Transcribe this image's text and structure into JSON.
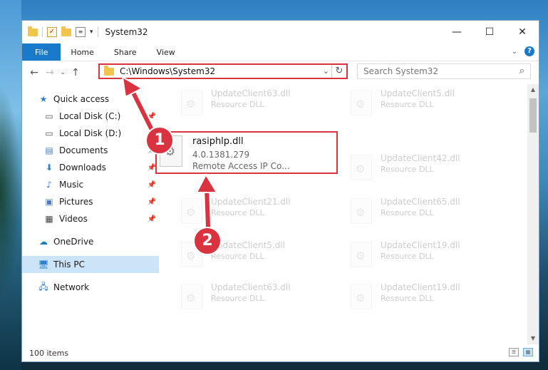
{
  "window": {
    "title": "System32",
    "controls": {
      "minimize": "—",
      "maximize": "☐",
      "close": "✕"
    }
  },
  "ribbon": {
    "tabs": [
      "File",
      "Home",
      "Share",
      "View"
    ]
  },
  "navigation": {
    "address": "C:\\Windows\\System32",
    "search_placeholder": "Search System32"
  },
  "sidebar": {
    "items": [
      {
        "label": "Quick access",
        "icon": "star-icon",
        "pinned": false
      },
      {
        "label": "Local Disk (C:)",
        "icon": "drive-icon",
        "pinned": true
      },
      {
        "label": "Local Disk (D:)",
        "icon": "drive-icon",
        "pinned": true
      },
      {
        "label": "Documents",
        "icon": "document-icon",
        "pinned": true
      },
      {
        "label": "Downloads",
        "icon": "download-icon",
        "pinned": true
      },
      {
        "label": "Music",
        "icon": "music-icon",
        "pinned": true
      },
      {
        "label": "Pictures",
        "icon": "picture-icon",
        "pinned": true
      },
      {
        "label": "Videos",
        "icon": "video-icon",
        "pinned": true
      },
      {
        "label": "OneDrive",
        "icon": "cloud-icon",
        "pinned": false
      },
      {
        "label": "This PC",
        "icon": "computer-icon",
        "pinned": false,
        "selected": true
      },
      {
        "label": "Network",
        "icon": "network-icon",
        "pinned": false
      }
    ]
  },
  "files": {
    "left_column": [
      {
        "name": "UpdateClient63.dll",
        "desc": "Resource DLL"
      },
      {
        "name": "UpdateClient21.dll",
        "desc": "Resource DLL"
      },
      {
        "name": "UpdateClient5.dll",
        "desc": "Resource DLL"
      },
      {
        "name": "UpdateClient63.dll",
        "desc": "Resource DLL"
      }
    ],
    "right_column": [
      {
        "name": "UpdateClient5.dll",
        "desc": "Resource DLL"
      },
      {
        "name": "UpdateClient42.dll",
        "desc": "Resource DLL"
      },
      {
        "name": "UpdateClient65.dll",
        "desc": "Resource DLL"
      },
      {
        "name": "UpdateClient19.dll",
        "desc": "Resource DLL"
      },
      {
        "name": "UpdateClient19.dll",
        "desc": "Resource DLL"
      }
    ],
    "highlighted": {
      "name": "rasiphlp.dll",
      "version": "4.0.1381.279",
      "desc": "Remote Access IP Co..."
    }
  },
  "status": {
    "count": "100 items"
  },
  "annotations": {
    "step1": "1",
    "step2": "2",
    "color": "#d9333f"
  }
}
